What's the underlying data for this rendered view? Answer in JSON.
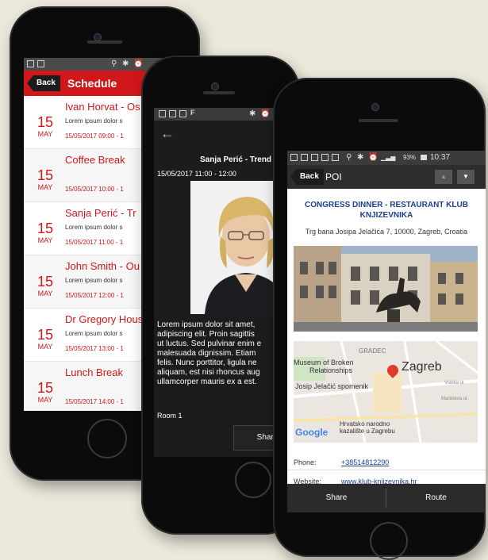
{
  "schedule": {
    "status_time": "",
    "back_label": "Back",
    "title": "Schedule",
    "items": [
      {
        "day": "15",
        "month": "MAY",
        "title": "Ivan Horvat - Os",
        "desc": "Lorem ipsum dolor s",
        "time": "15/05/2017 09:00 - 1"
      },
      {
        "day": "15",
        "month": "MAY",
        "title": "Coffee Break",
        "desc": "",
        "time": "15/05/2017 10:00 - 1"
      },
      {
        "day": "15",
        "month": "MAY",
        "title": "Sanja Perić - Tr",
        "desc": "Lorem ipsum dolor s",
        "time": "15/05/2017 11:00 - 1"
      },
      {
        "day": "15",
        "month": "MAY",
        "title": "John Smith - Ou",
        "desc": "Lorem ipsum dolor s",
        "time": "15/05/2017 12:00 - 1"
      },
      {
        "day": "15",
        "month": "MAY",
        "title": "Dr Gregory Hous",
        "desc": "Lorem ipsum dolor s",
        "time": "15/05/2017 13:00 - 1"
      },
      {
        "day": "15",
        "month": "MAY",
        "title": "Lunch Break",
        "desc": "",
        "time": "15/05/2017 14:00 - 1"
      }
    ]
  },
  "session": {
    "back_icon": "←",
    "title": "Sanja Perić - Trend",
    "time": "15/05/2017 11:00 - 12:00",
    "body": [
      "Lorem ipsum dolor sit amet,",
      "adipiscing elit. Proin sagittis",
      "ut luctus. Sed pulvinar enim e",
      "malesuada dignissim. Etiam",
      "felis. Nunc porttitor, ligula ne",
      "aliquam, est nisi rhoncus aug",
      "ullamcorper mauris ex a est."
    ],
    "room": "Room 1",
    "share_label": "Share"
  },
  "poi": {
    "status_battery": "93%",
    "status_time": "10:37",
    "back_label": "Back",
    "title": "POI",
    "name_line1": "CONGRESS DINNER - RESTAURANT KLUB",
    "name_line2": "KNJIZEVNIKA",
    "address": "Trg bana Josipa Jelačića 7, 10000, Zagreb, Croatia",
    "map": {
      "gradec": "GRADEC",
      "museum_line1": "Museum of Broken",
      "museum_line2": "Relationships",
      "zagreb": "Zagreb",
      "jelacic": "Josip Jelačić spomenik",
      "theatre_line1": "Hrvatsko narodno",
      "theatre_line2": "kazalište u Zagrebu",
      "vlaska": "Vlaška ul.",
      "marticeva": "Martićeva ul.",
      "google": "Google"
    },
    "phone_label": "Phone:",
    "phone_value": "+38514812290",
    "website_label": "Website:",
    "website_value": "www.klub-knjizevnika.hr",
    "share_label": "Share",
    "route_label": "Route"
  },
  "colors": {
    "accent_red": "#d0171c",
    "poi_blue": "#1d3f8f",
    "dark_bg": "#1c1c1c"
  }
}
